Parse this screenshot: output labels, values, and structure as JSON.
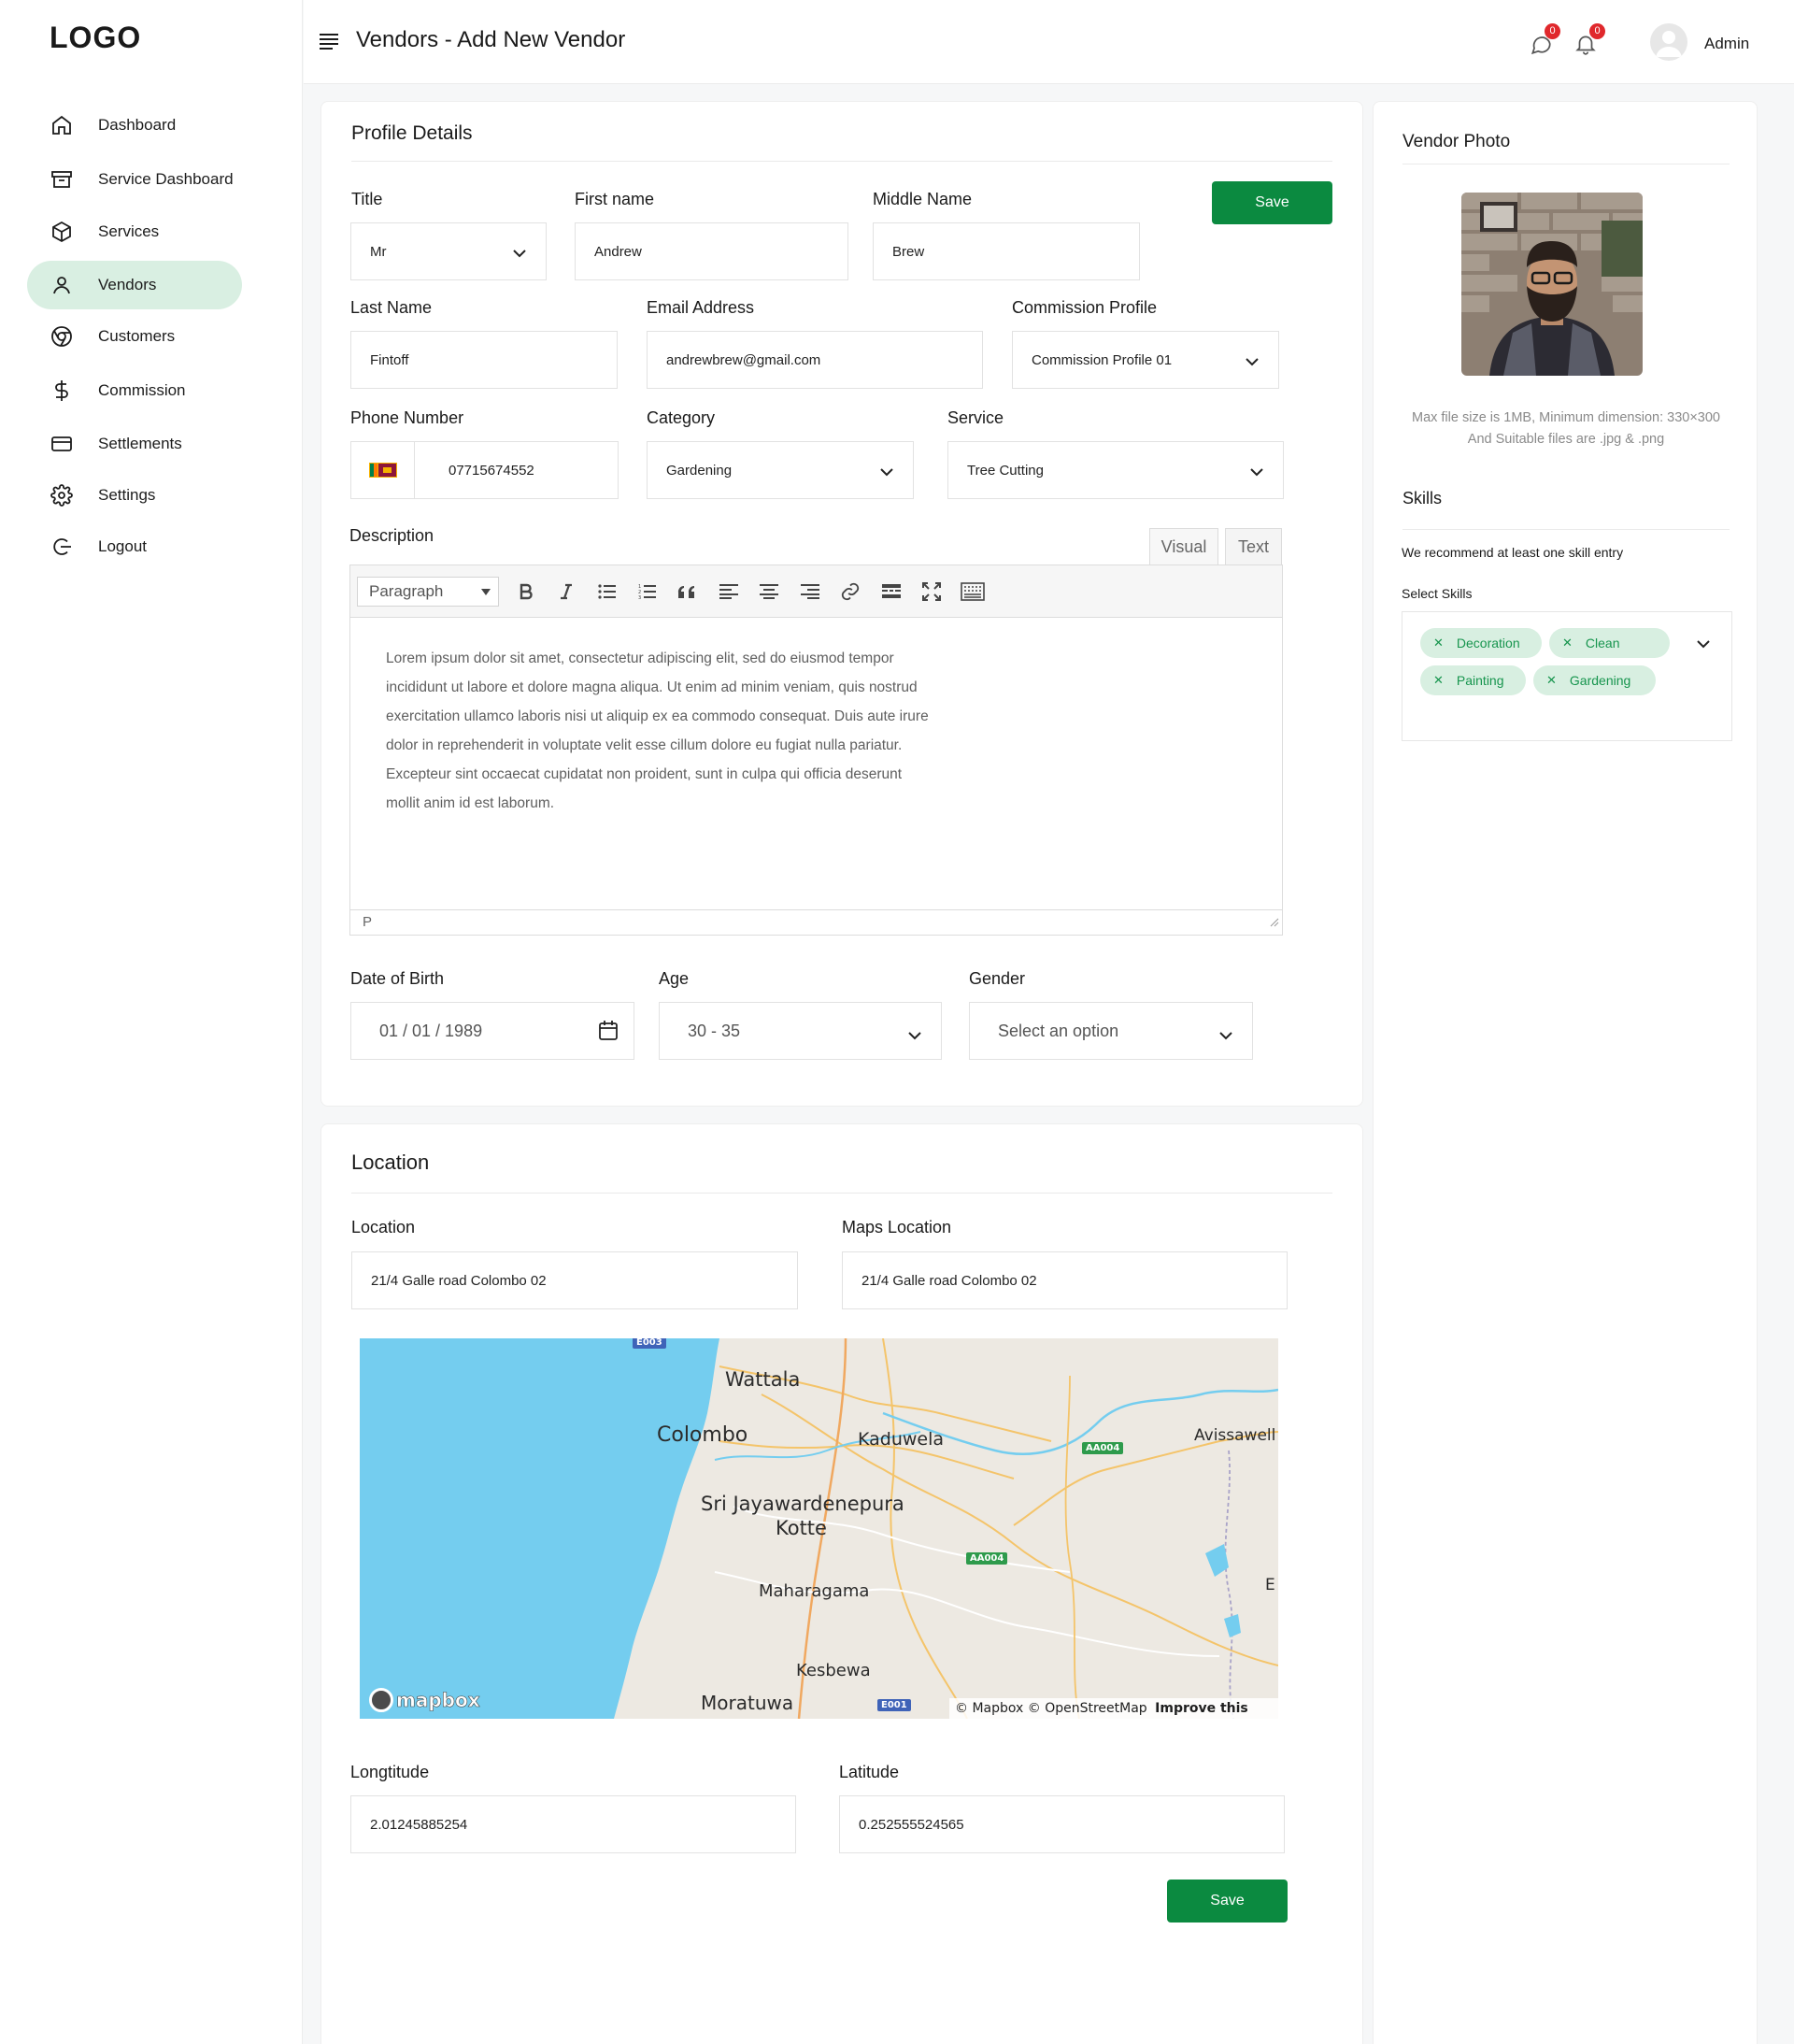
{
  "app": {
    "logo": "LOGO"
  },
  "sidebar": {
    "items": [
      {
        "label": "Dashboard",
        "icon": "home-icon"
      },
      {
        "label": "Service Dashboard",
        "icon": "archive-icon"
      },
      {
        "label": "Services",
        "icon": "cube-icon"
      },
      {
        "label": "Vendors",
        "icon": "user-icon",
        "active": true
      },
      {
        "label": "Customers",
        "icon": "chrome-icon"
      },
      {
        "label": "Commission",
        "icon": "dollar-icon"
      },
      {
        "label": "Settlements",
        "icon": "card-icon"
      },
      {
        "label": "Settings",
        "icon": "gear-icon"
      },
      {
        "label": "Logout",
        "icon": "logout-icon"
      }
    ]
  },
  "header": {
    "title": "Vendors - Add New Vendor",
    "messages_count": "0",
    "notifications_count": "0",
    "user_name": "Admin"
  },
  "profile": {
    "section_title": "Profile Details",
    "save_label": "Save",
    "title_label": "Title",
    "title_value": "Mr",
    "first_name_label": "First name",
    "first_name_value": "Andrew",
    "middle_name_label": "Middle Name",
    "middle_name_value": "Brew",
    "last_name_label": "Last Name",
    "last_name_value": "Fintoff",
    "email_label": "Email Address",
    "email_value": "andrewbrew@gmail.com",
    "commission_label": "Commission Profile",
    "commission_value": "Commission Profile 01",
    "phone_label": "Phone Number",
    "phone_value": "07715674552",
    "category_label": "Category",
    "category_value": "Gardening",
    "service_label": "Service",
    "service_value": "Tree Cutting",
    "description_label": "Description",
    "editor": {
      "tab_visual": "Visual",
      "tab_text": "Text",
      "format": "Paragraph",
      "content": "Lorem ipsum dolor sit amet, consectetur adipiscing elit, sed do eiusmod tempor\nincididunt ut labore et dolore magna aliqua. Ut enim ad minim veniam, quis nostrud\n exercitation ullamco laboris nisi ut aliquip ex ea commodo consequat. Duis aute irure\ndolor in reprehenderit in voluptate velit esse cillum dolore eu fugiat nulla pariatur.\nExcepteur sint occaecat cupidatat non proident, sunt in culpa qui officia deserunt\nmollit anim id est laborum.",
      "status": "P"
    },
    "dob_label": "Date of Birth",
    "dob_value": "01 / 01 / 1989",
    "age_label": "Age",
    "age_value": "30 - 35",
    "gender_label": "Gender",
    "gender_placeholder": "Select an option"
  },
  "location": {
    "section_title": "Location",
    "location_label": "Location",
    "location_value": "21/4 Galle road Colombo 02",
    "maps_location_label": "Maps Location",
    "maps_location_value": "21/4 Galle road Colombo 02",
    "map": {
      "places": [
        "Wattala",
        "Colombo",
        "Kaduwela",
        "Sri Jayawardenepura",
        "Kotte",
        "Maharagama",
        "Kesbewa",
        "Moratuwa",
        "Avissawell",
        "E"
      ],
      "road_shields": [
        "E003",
        "AA004",
        "AA004",
        "E001"
      ],
      "brand": "mapbox",
      "attribution": "© Mapbox © OpenStreetMap",
      "improve": "Improve this map"
    },
    "longitude_label": "Longtitude",
    "longitude_value": "2.01245885254",
    "latitude_label": "Latitude",
    "latitude_value": "0.252555524565",
    "save_label": "Save"
  },
  "vendor_photo": {
    "title": "Vendor Photo",
    "hint": "Max file size is 1MB, Minimum dimension: 330×300 And Suitable files are .jpg & .png"
  },
  "skills": {
    "title": "Skills",
    "recommend": "We recommend at least one skill entry",
    "select_label": "Select Skills",
    "selected": [
      "Decoration",
      "Clean",
      "Painting",
      "Gardening"
    ]
  },
  "colors": {
    "accent": "#0b8a40",
    "active_nav": "#d9efe2",
    "chip_bg": "#d8efe1",
    "chip_text": "#17954e",
    "badge": "#e0282c",
    "water": "#74cdef"
  }
}
